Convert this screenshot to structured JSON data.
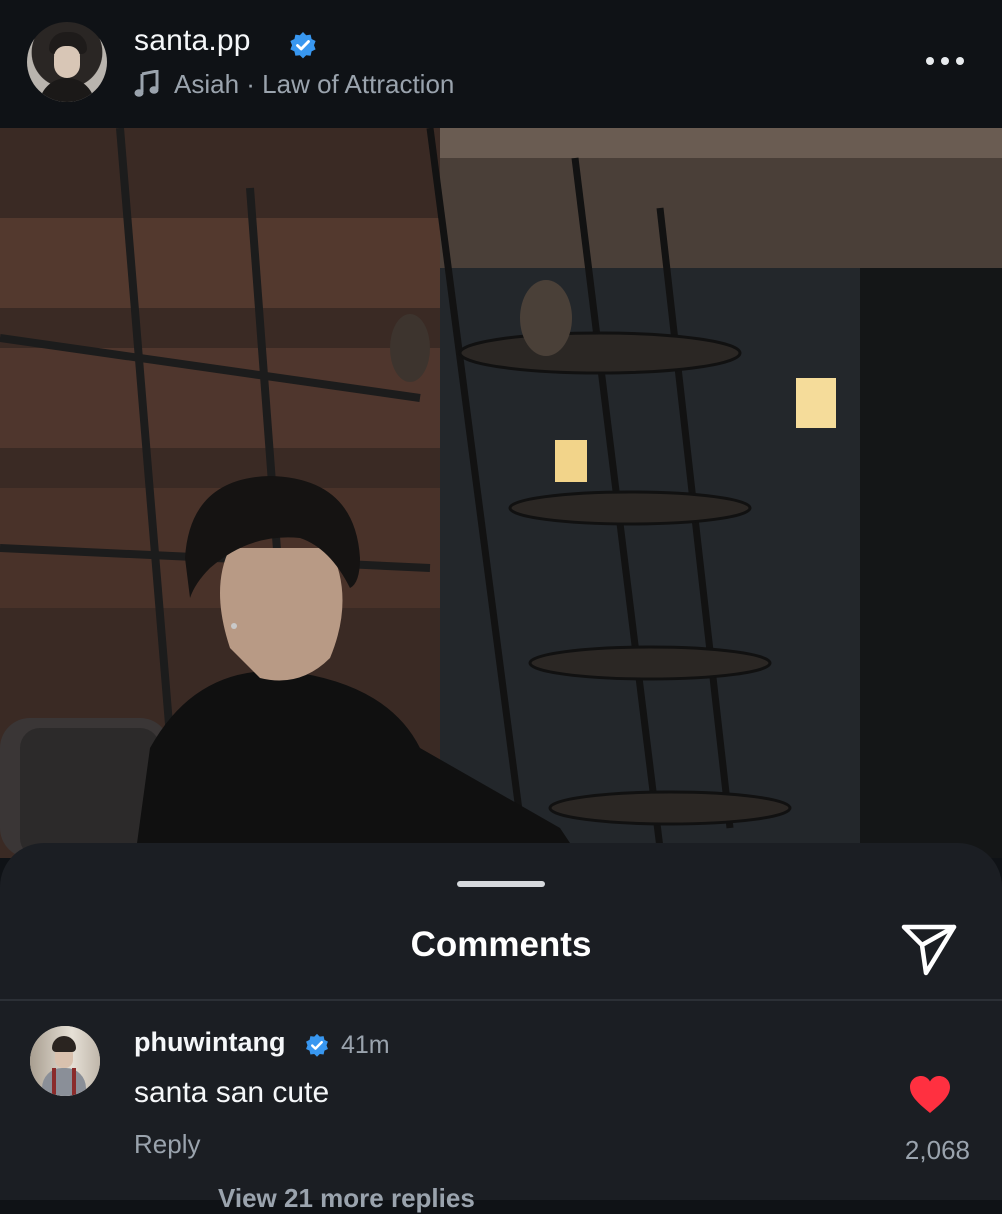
{
  "header": {
    "username": "santa.pp",
    "verified_icon": "verified-badge-icon",
    "music_icon": "music-note-icon",
    "audio_label": "Asiah · Law of Attraction",
    "more_icon": "more-horizontal-icon"
  },
  "photo": {
    "description_icon": "post-photo"
  },
  "comments_sheet": {
    "title": "Comments",
    "share_icon": "send-icon",
    "comments": [
      {
        "username": "phuwintang",
        "verified": true,
        "time": "41m",
        "text": "santa san cute",
        "reply_label": "Reply",
        "like_count": "2,068",
        "liked": true,
        "view_more_replies": "View 21 more replies"
      }
    ]
  },
  "colors": {
    "background": "#0f1216",
    "sheet": "#1b1e23",
    "verified_blue": "#3897f0",
    "like_red": "#ff3040",
    "secondary_text": "#9aa3ad"
  }
}
